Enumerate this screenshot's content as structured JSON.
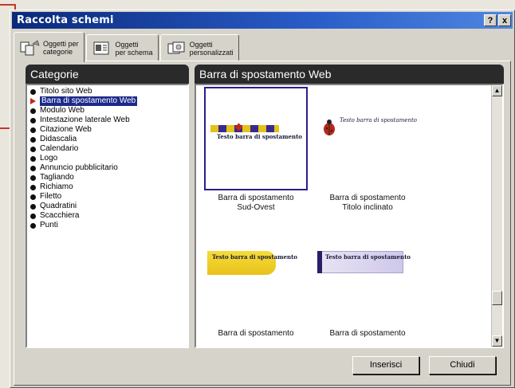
{
  "window": {
    "title": "Raccolta schemi",
    "help_label": "?",
    "close_label": "x"
  },
  "tabs": [
    {
      "label": "Oggetti per\ncategorie"
    },
    {
      "label": "Oggetti\nper schema"
    },
    {
      "label": "Oggetti\npersonalizzati"
    }
  ],
  "categories_header": "Categorie",
  "categories": [
    "Titolo sito Web",
    "Barra di spostamento Web",
    "Modulo Web",
    "Intestazione laterale Web",
    "Citazione Web",
    "Didascalia",
    "Calendario",
    "Logo",
    "Annuncio pubblicitario",
    "Tagliando",
    "Richiamo",
    "Filetto",
    "Quadratini",
    "Scacchiera",
    "Punti"
  ],
  "selected_category_index": 1,
  "gallery_header": "Barra di spostamento Web",
  "gallery_items": [
    {
      "caption": "Barra di spostamento\nSud-Ovest",
      "sample_text": "Testo barra di\nspostamento"
    },
    {
      "caption": "Barra di spostamento\nTitolo inclinato",
      "sample_text": "Testo barra di\nspostamento"
    },
    {
      "caption": "Barra di spostamento",
      "sample_text": "Testo barra di\nspostamento"
    },
    {
      "caption": "Barra di spostamento",
      "sample_text": "Testo barra di\nspostamento"
    }
  ],
  "buttons": {
    "insert_label": "Inserisci",
    "close_label": "Chiudi"
  },
  "colors": {
    "title_bar": "#0a2a7a",
    "selection": "#1b2a8a",
    "accent_red": "#c23a2a"
  }
}
